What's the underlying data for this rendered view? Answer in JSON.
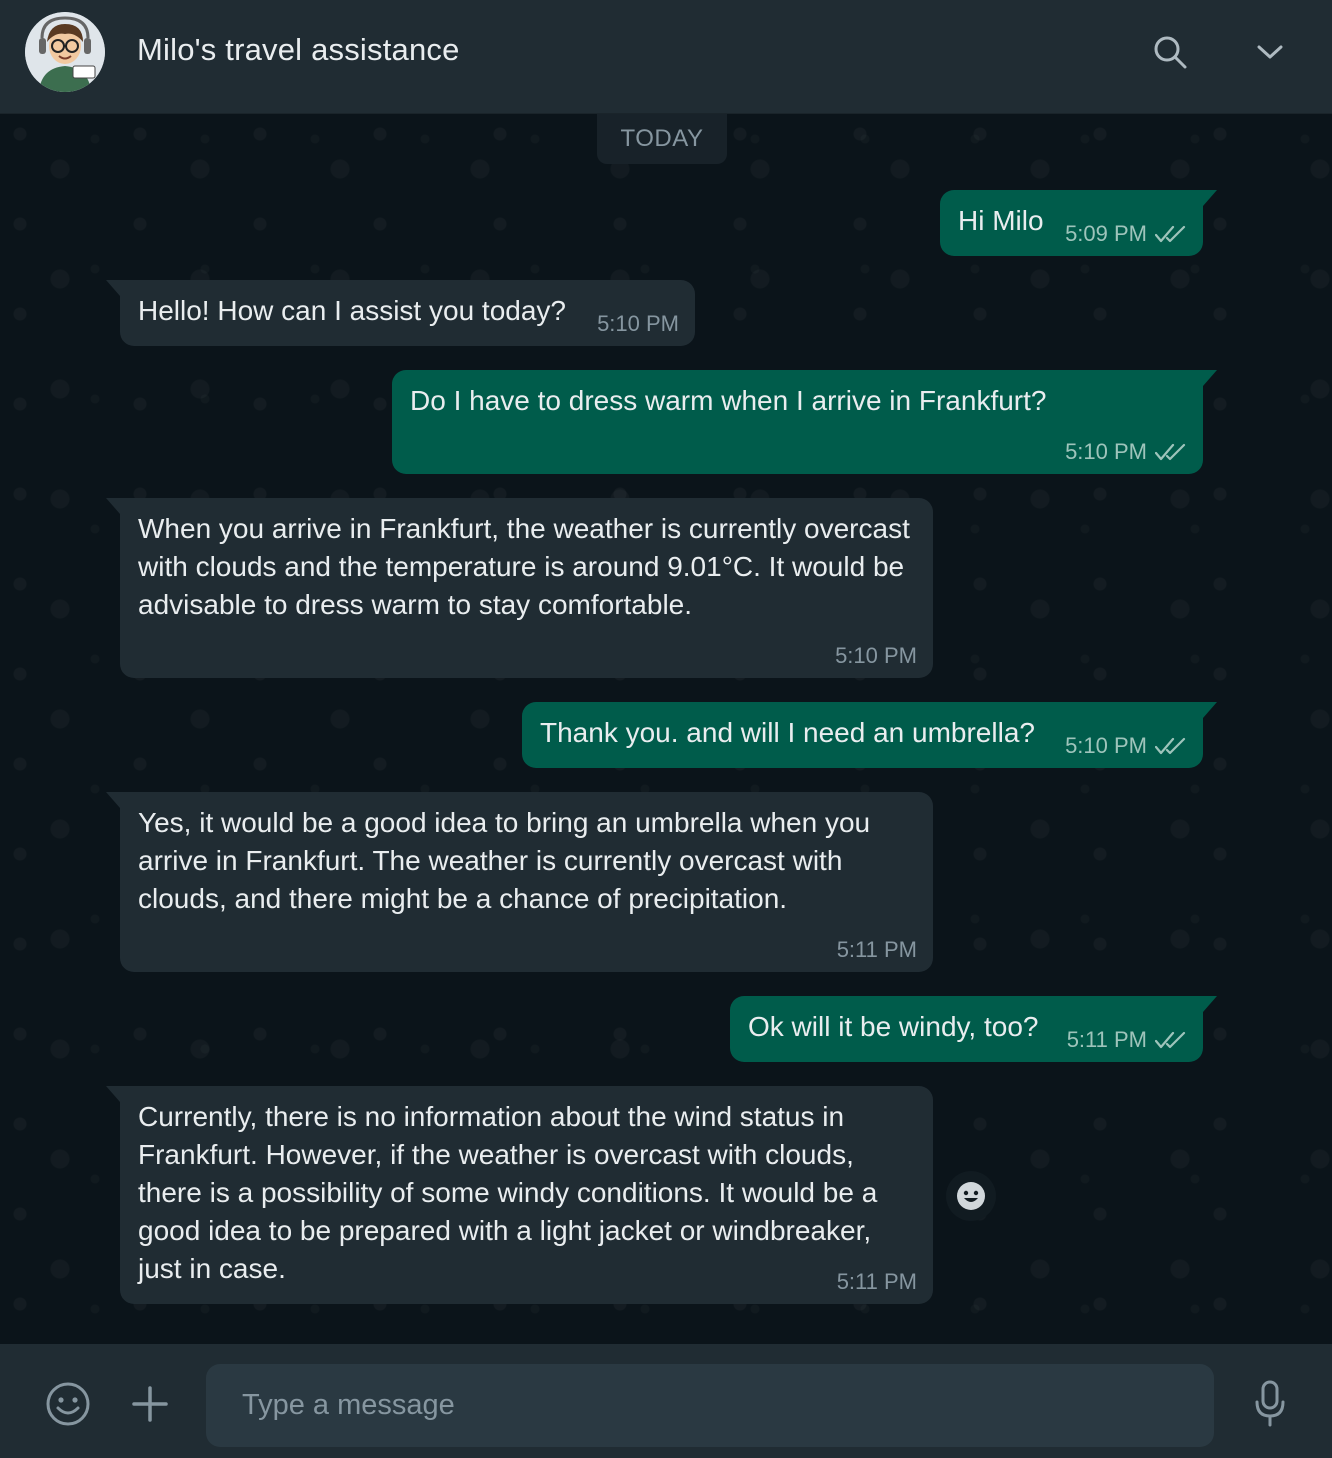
{
  "header": {
    "title": "Milo's travel assistance",
    "avatar_icon": "milo-cartoon-avatar",
    "search_icon": "search-icon",
    "menu_icon": "chevron-down-icon"
  },
  "chat": {
    "date_label": "TODAY",
    "messages": [
      {
        "dir": "out",
        "text": "Hi Milo",
        "time": "5:09 PM",
        "status": "read"
      },
      {
        "dir": "in",
        "text": "Hello! How can I assist you today?",
        "time": "5:10 PM"
      },
      {
        "dir": "out",
        "text": "Do I have to dress warm when I arrive in Frankfurt?",
        "time": "5:10 PM",
        "status": "read"
      },
      {
        "dir": "in",
        "text": "When you arrive in Frankfurt, the weather is currently overcast with clouds and the temperature is around 9.01°C. It would be advisable to dress warm to stay comfortable.",
        "time": "5:10 PM"
      },
      {
        "dir": "out",
        "text": "Thank you. and will I need an umbrella?",
        "time": "5:10 PM",
        "status": "read"
      },
      {
        "dir": "in",
        "text": "Yes, it would be a good idea to bring an umbrella when you arrive in Frankfurt. The weather is currently overcast with clouds, and there might be a chance of precipitation.",
        "time": "5:11 PM"
      },
      {
        "dir": "out",
        "text": "Ok will it be windy, too?",
        "time": "5:11 PM",
        "status": "read"
      },
      {
        "dir": "in",
        "text": "Currently, there is no information about the wind status in Frankfurt. However, if the weather is overcast with clouds, there is a possibility of some windy conditions. It would be a good idea to be prepared with a light jacket or windbreaker, just in case.",
        "time": "5:11 PM"
      }
    ]
  },
  "composer": {
    "placeholder": "Type a message",
    "value": ""
  },
  "colors": {
    "header_bg": "#202c33",
    "chat_bg": "#0b141a",
    "incoming_bubble": "#202c33",
    "outgoing_bubble": "#005c4b",
    "text": "#e9edef",
    "muted": "#8696a0"
  }
}
